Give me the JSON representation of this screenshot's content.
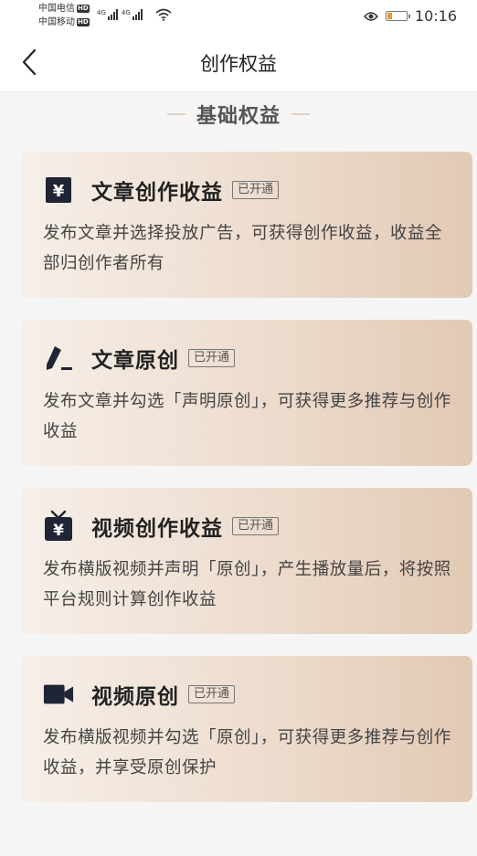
{
  "status_bar": {
    "carrier1": "中国电信",
    "carrier2": "中国移动",
    "hd": "HD",
    "network": "4G",
    "time": "10:16"
  },
  "header": {
    "title": "创作权益"
  },
  "section": {
    "title": "基础权益"
  },
  "cards": [
    {
      "icon": "yen-icon",
      "title": "文章创作收益",
      "badge": "已开通",
      "desc": "发布文章并选择投放广告，可获得创作收益，收益全部归创作者所有"
    },
    {
      "icon": "pen-icon",
      "title": "文章原创",
      "badge": "已开通",
      "desc": "发布文章并勾选「声明原创」，可获得更多推荐与创作收益"
    },
    {
      "icon": "tv-yen-icon",
      "title": "视频创作收益",
      "badge": "已开通",
      "desc": "发布横版视频并声明「原创」，产生播放量后，将按照平台规则计算创作收益"
    },
    {
      "icon": "video-camera-icon",
      "title": "视频原创",
      "badge": "已开通",
      "desc": "发布横版视频并勾选「原创」，可获得更多推荐与创作收益，并享受原创保护"
    }
  ]
}
